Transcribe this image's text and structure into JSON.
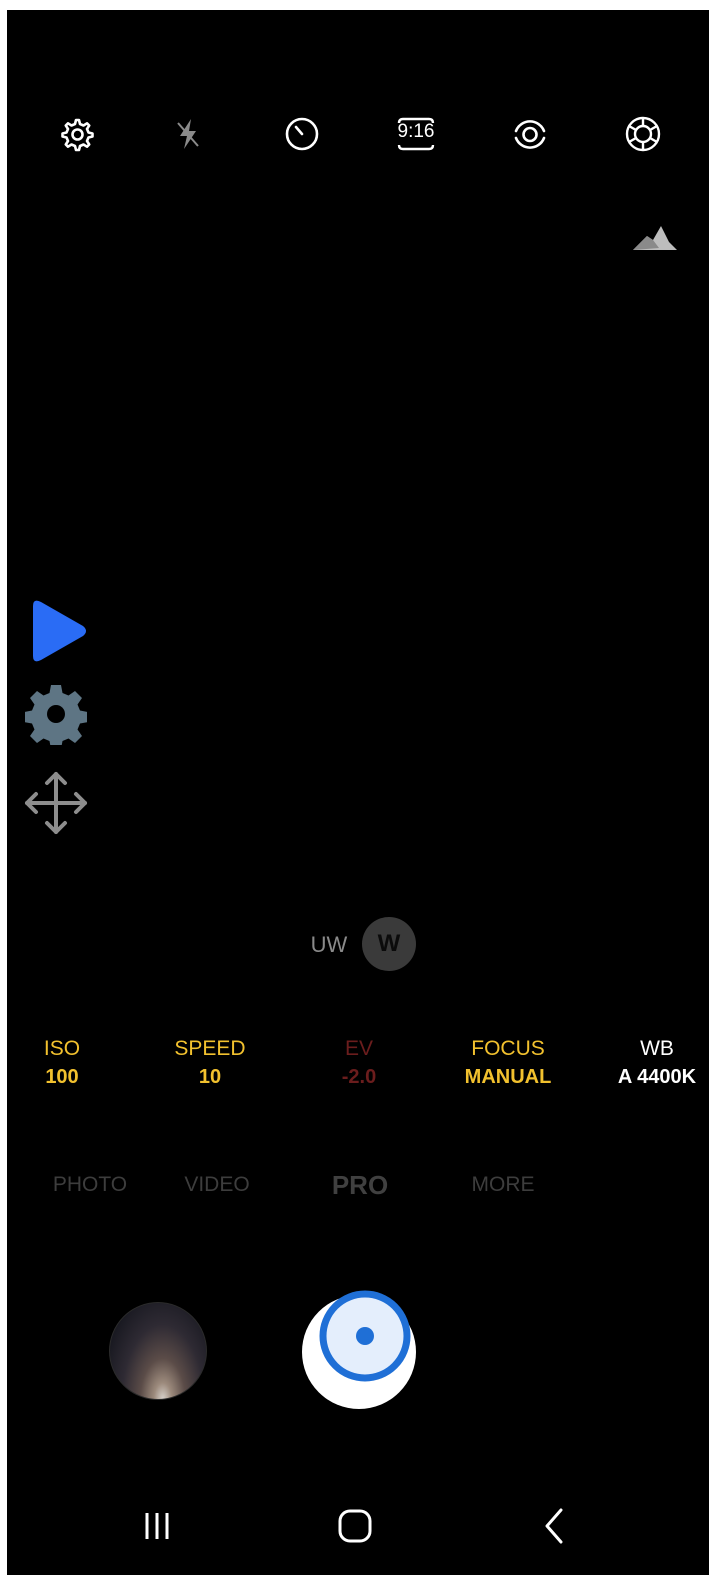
{
  "toolbar": {
    "icons": [
      "settings-icon",
      "flash-off-icon",
      "timer-icon",
      "aspect-ratio-icon",
      "motion-photo-icon",
      "filters-icon"
    ],
    "aspect_ratio_label": "9:16"
  },
  "histogram": {
    "icon": "histogram-icon"
  },
  "overlay": {
    "icons": [
      "play-icon",
      "gear-icon",
      "move-icon"
    ],
    "play_color": "#2a6cf5",
    "gear_color": "#5e7584",
    "move_color": "#8d8d8d"
  },
  "lens": {
    "uw_label": "UW",
    "w_label": "W",
    "selected": "W"
  },
  "pro_settings": [
    {
      "label": "ISO",
      "value": "100",
      "label_color": "#f2c12e",
      "value_color": "#f2c12e"
    },
    {
      "label": "SPEED",
      "value": "10",
      "label_color": "#f2c12e",
      "value_color": "#f2c12e"
    },
    {
      "label": "EV",
      "value": "-2.0",
      "label_color": "#6b1d1d",
      "value_color": "#6b1d1d"
    },
    {
      "label": "FOCUS",
      "value": "MANUAL",
      "label_color": "#f2c12e",
      "value_color": "#f2c12e"
    },
    {
      "label": "WB",
      "value": "A 4400K",
      "label_color": "#ffffff",
      "value_color": "#ffffff"
    }
  ],
  "modes": [
    "PHOTO",
    "VIDEO",
    "PRO",
    "MORE"
  ],
  "selected_mode": "PRO",
  "shutter": {
    "ring_color": "#1f6fd6",
    "fill_color": "#e4eefc"
  },
  "nav": {
    "icons": [
      "recent-apps-icon",
      "home-icon",
      "back-icon"
    ]
  }
}
